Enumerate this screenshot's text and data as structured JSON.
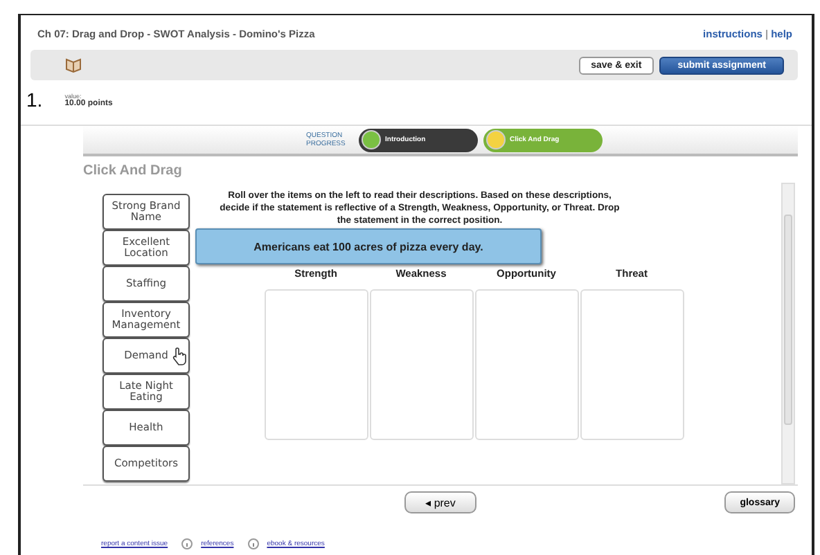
{
  "header": {
    "title": "Ch 07: Drag and Drop - SWOT Analysis - Domino's Pizza",
    "links": [
      "instructions",
      "help"
    ],
    "separator": "|"
  },
  "toolbar": {
    "buttons": [
      {
        "label": "save & exit",
        "kind": "plain"
      },
      {
        "label": "submit assignment",
        "kind": "primary"
      }
    ]
  },
  "question": {
    "number": "1.",
    "value_label": "value:",
    "points": "10.00 points"
  },
  "progress": {
    "label": "QUESTION PROGRESS",
    "steps": [
      {
        "label": "Introduction",
        "selected": false
      },
      {
        "label": "Click And Drag",
        "selected": true
      }
    ]
  },
  "section_title": "Click And Drag",
  "items": [
    {
      "label": "Strong Brand Name",
      "hovered": false
    },
    {
      "label": "Excellent Location",
      "hovered": false
    },
    {
      "label": "Staffing",
      "hovered": false
    },
    {
      "label": "Inventory Management",
      "hovered": false
    },
    {
      "label": "Demand",
      "hovered": true
    },
    {
      "label": "Late Night Eating",
      "hovered": false
    },
    {
      "label": "Health",
      "hovered": false
    },
    {
      "label": "Competitors",
      "hovered": false
    }
  ],
  "instructions": "Roll over the items on the left to read their descriptions. Based on these descriptions, decide if the statement is reflective of a Strength, Weakness, Opportunity, or Threat. Drop the statement in the correct position.",
  "statement": "Americans eat 100 acres of pizza every day.",
  "columns": [
    "Strength",
    "Weakness",
    "Opportunity",
    "Threat"
  ],
  "nav": {
    "prev": "◂ prev",
    "glossary": "glossary"
  },
  "footer": [
    "report a content issue",
    "references",
    "ebook & resources"
  ]
}
